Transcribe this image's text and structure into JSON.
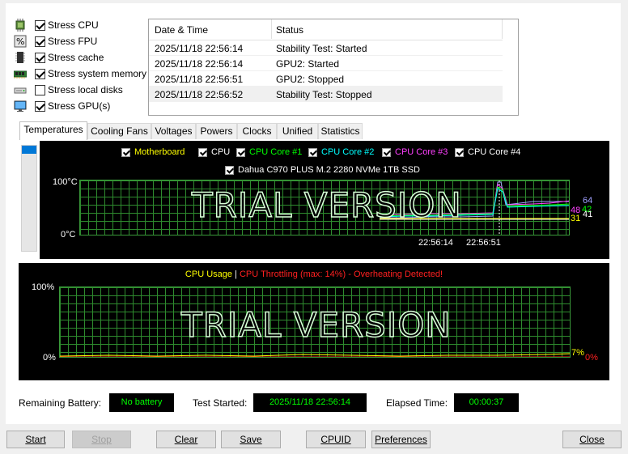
{
  "stress_options": [
    {
      "label": "Stress CPU",
      "checked": true,
      "icon": "cpu-chip-icon"
    },
    {
      "label": "Stress FPU",
      "checked": true,
      "icon": "fpu-percent-icon"
    },
    {
      "label": "Stress cache",
      "checked": true,
      "icon": "cache-chip-icon"
    },
    {
      "label": "Stress system memory",
      "checked": true,
      "icon": "memory-module-icon"
    },
    {
      "label": "Stress local disks",
      "checked": false,
      "icon": "disk-drive-icon"
    },
    {
      "label": "Stress GPU(s)",
      "checked": true,
      "icon": "monitor-gpu-icon"
    }
  ],
  "log": {
    "columns": [
      "Date & Time",
      "Status"
    ],
    "rows": [
      {
        "time": "2025/11/18 22:56:14",
        "status": "Stability Test: Started"
      },
      {
        "time": "2025/11/18 22:56:14",
        "status": "GPU2: Started"
      },
      {
        "time": "2025/11/18 22:56:51",
        "status": "GPU2: Stopped"
      },
      {
        "time": "2025/11/18 22:56:52",
        "status": "Stability Test: Stopped"
      }
    ]
  },
  "tabs": [
    "Temperatures",
    "Cooling Fans",
    "Voltages",
    "Powers",
    "Clocks",
    "Unified",
    "Statistics"
  ],
  "active_tab": "Temperatures",
  "temp_chart": {
    "legend": [
      {
        "label": "Motherboard",
        "color": "#ffff00"
      },
      {
        "label": "CPU",
        "color": "#ffffff"
      },
      {
        "label": "CPU Core #1",
        "color": "#00ff00"
      },
      {
        "label": "CPU Core #2",
        "color": "#00ffff"
      },
      {
        "label": "CPU Core #3",
        "color": "#ff40ff"
      },
      {
        "label": "CPU Core #4",
        "color": "#ffffff"
      },
      {
        "label": "Dahua C970 PLUS M.2 2280 NVMe 1TB SSD",
        "color": "#ffffff"
      }
    ],
    "y_max_label": "100°C",
    "y_min_label": "0°C",
    "x_labels": [
      "22:56:14",
      "22:56:51"
    ],
    "watermark": "TRIAL VERSION",
    "current_values": [
      {
        "value": "64",
        "color": "#a0a0ff"
      },
      {
        "value": "48",
        "color": "#ff40ff"
      },
      {
        "value": "42",
        "color": "#00ff00"
      },
      {
        "value": "41",
        "color": "#ffffff"
      },
      {
        "value": "31",
        "color": "#ffff00"
      }
    ]
  },
  "cpu_chart": {
    "title_usage": "CPU Usage",
    "separator": "|",
    "title_throttle": "CPU Throttling (max: 14%) - Overheating Detected!",
    "usage_color": "#ffff00",
    "throttle_color": "#ff2020",
    "y_max_label": "100%",
    "y_min_label": "0%",
    "watermark": "TRIAL VERSION",
    "usage_value": "7%",
    "throttle_value": "0%"
  },
  "status_bar": {
    "battery_label": "Remaining Battery:",
    "battery_value": "No battery",
    "started_label": "Test Started:",
    "started_value": "2025/11/18 22:56:14",
    "elapsed_label": "Elapsed Time:",
    "elapsed_value": "00:00:37"
  },
  "buttons": {
    "start": "Start",
    "stop": "Stop",
    "clear": "Clear",
    "save": "Save",
    "cpuid": "CPUID",
    "preferences": "Preferences",
    "close": "Close"
  }
}
